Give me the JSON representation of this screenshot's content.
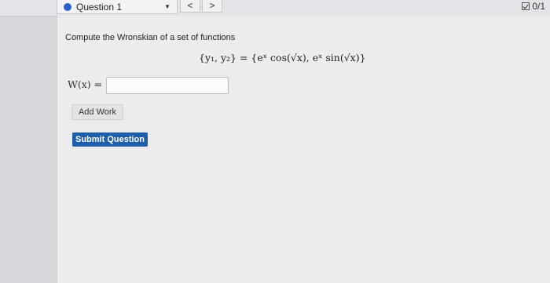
{
  "header": {
    "question_label": "Question 1",
    "prev_label": "<",
    "next_label": ">",
    "score": "0/1"
  },
  "problem": {
    "prompt": "Compute the Wronskian of a set of functions",
    "formula": "{y₁, y₂} = {eˣ cos(√x), eˣ sin(√x)}",
    "answer_label": "W(x) =",
    "answer_value": ""
  },
  "buttons": {
    "add_work": "Add Work",
    "submit": "Submit Question"
  },
  "colors": {
    "accent": "#2b63c9",
    "submit_bg": "#1f5ea8"
  }
}
